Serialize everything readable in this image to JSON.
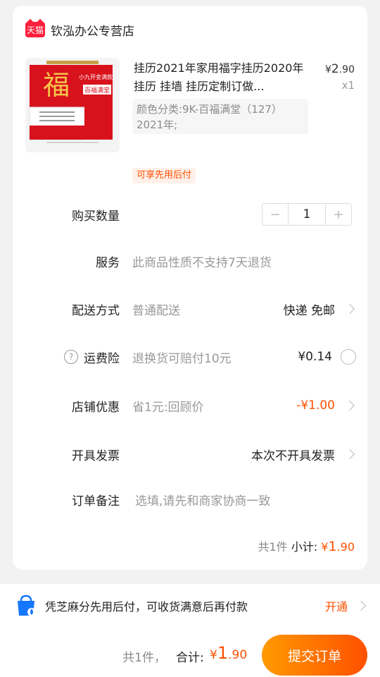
{
  "store": {
    "logo_text": "天猫",
    "name": "钦泓办公专营店"
  },
  "product": {
    "image_text": [
      "福",
      "小九开金满款",
      "百福满堂"
    ],
    "title": "挂历2021年家用福字挂历2020年挂历 挂墙 挂历定制订做...",
    "price_symbol": "¥",
    "price_int": "2",
    "price_dec": ".90",
    "quantity_label": "x1",
    "sku": "颜色分类:9K-百福满堂（127）2021年;",
    "badge": "可享先用后付"
  },
  "rows": {
    "quantity": {
      "label": "购买数量",
      "minus": "−",
      "value": "1",
      "plus": "+"
    },
    "service": {
      "label": "服务",
      "value": "此商品性质不支持7天退货"
    },
    "delivery": {
      "label": "配送方式",
      "value": "普通配送",
      "right": "快递 免邮"
    },
    "insurance": {
      "label": "运费险",
      "help": "?",
      "value": "退换货可赔付10元",
      "right": "¥0.14"
    },
    "discount": {
      "label": "店铺优惠",
      "value": "省1元:回顾价",
      "right": "-¥1.00"
    },
    "invoice": {
      "label": "开具发票",
      "right": "本次不开具发票"
    },
    "note": {
      "label": "订单备注",
      "placeholder": "选填,请先和商家协商一致"
    }
  },
  "subtotal": {
    "count": "共1件",
    "label": "小计:",
    "symbol": "¥",
    "int": "1",
    "dec": ".90"
  },
  "zhima": {
    "text": "凭芝麻分先用后付，可收货满意后再付款",
    "action": "开通"
  },
  "footer": {
    "count": "共1件，",
    "total_label": "合计:",
    "symbol": "¥",
    "int": "1",
    "dec": ".90",
    "submit": "提交订单"
  },
  "colors": {
    "accent": "#ff5000",
    "tmall": "#ff1f3c"
  }
}
